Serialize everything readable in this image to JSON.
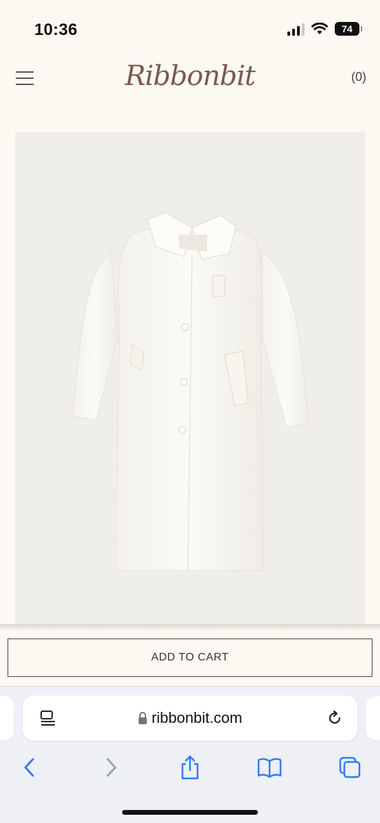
{
  "status_bar": {
    "time": "10:36",
    "battery": "74",
    "icons": [
      "signal-icon",
      "wifi-icon",
      "battery-icon"
    ]
  },
  "header": {
    "brand": "Ribbonbit",
    "cart_count": "(0)",
    "menu_icon": "hamburger-menu-icon"
  },
  "product": {
    "image_subject": "white long coat"
  },
  "actions": {
    "add_to_cart": "ADD TO CART"
  },
  "browser": {
    "url": "ribbonbit.com",
    "icons": [
      "reader-icon",
      "lock-icon",
      "reload-icon",
      "back-icon",
      "forward-icon",
      "share-icon",
      "bookmarks-icon",
      "tabs-icon"
    ]
  },
  "colors": {
    "page_background": "#fbf9f2",
    "brand": "#7a5a4e",
    "image_background": "#efeee8",
    "safari_accent": "#2f7cf6"
  }
}
